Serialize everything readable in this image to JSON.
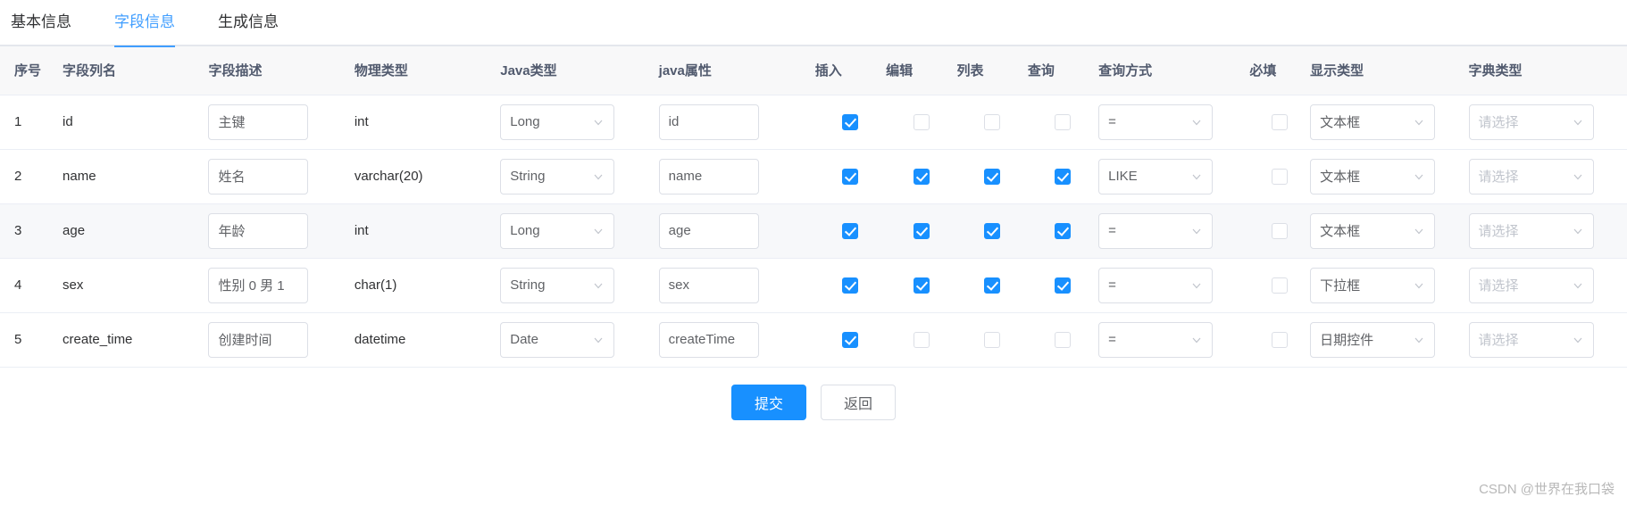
{
  "theme": {
    "accent": "#409eff",
    "primary_button": "#1890ff",
    "checkbox_checked": "#1890ff",
    "header_bg": "#f8f8f9",
    "striped_row_bg": "#f7f8fa",
    "border": "#ebeef5"
  },
  "tabs": [
    {
      "label": "基本信息",
      "active": false
    },
    {
      "label": "字段信息",
      "active": true
    },
    {
      "label": "生成信息",
      "active": false
    }
  ],
  "table": {
    "columns": [
      "序号",
      "字段列名",
      "字段描述",
      "物理类型",
      "Java类型",
      "java属性",
      "插入",
      "编辑",
      "列表",
      "查询",
      "查询方式",
      "必填",
      "显示类型",
      "字典类型"
    ],
    "dict_placeholder": "请选择",
    "rows": [
      {
        "index": "1",
        "column_name": "id",
        "description": "主键",
        "physical_type": "int",
        "java_type": "Long",
        "java_property": "id",
        "insert": true,
        "edit": false,
        "list": false,
        "query": false,
        "query_mode": "=",
        "required": false,
        "display_type": "文本框",
        "dict_type": "",
        "striped": false
      },
      {
        "index": "2",
        "column_name": "name",
        "description": "姓名",
        "physical_type": "varchar(20)",
        "java_type": "String",
        "java_property": "name",
        "insert": true,
        "edit": true,
        "list": true,
        "query": true,
        "query_mode": "LIKE",
        "required": false,
        "display_type": "文本框",
        "dict_type": "",
        "striped": false
      },
      {
        "index": "3",
        "column_name": "age",
        "description": "年龄",
        "physical_type": "int",
        "java_type": "Long",
        "java_property": "age",
        "insert": true,
        "edit": true,
        "list": true,
        "query": true,
        "query_mode": "=",
        "required": false,
        "display_type": "文本框",
        "dict_type": "",
        "striped": true
      },
      {
        "index": "4",
        "column_name": "sex",
        "description": "性别 0 男 1",
        "physical_type": "char(1)",
        "java_type": "String",
        "java_property": "sex",
        "insert": true,
        "edit": true,
        "list": true,
        "query": true,
        "query_mode": "=",
        "required": false,
        "display_type": "下拉框",
        "dict_type": "",
        "striped": false
      },
      {
        "index": "5",
        "column_name": "create_time",
        "description": "创建时间",
        "physical_type": "datetime",
        "java_type": "Date",
        "java_property": "createTime",
        "insert": true,
        "edit": false,
        "list": false,
        "query": false,
        "query_mode": "=",
        "required": false,
        "display_type": "日期控件",
        "dict_type": "",
        "striped": false
      }
    ]
  },
  "footer": {
    "submit_label": "提交",
    "back_label": "返回"
  },
  "watermark": "CSDN @世界在我口袋"
}
